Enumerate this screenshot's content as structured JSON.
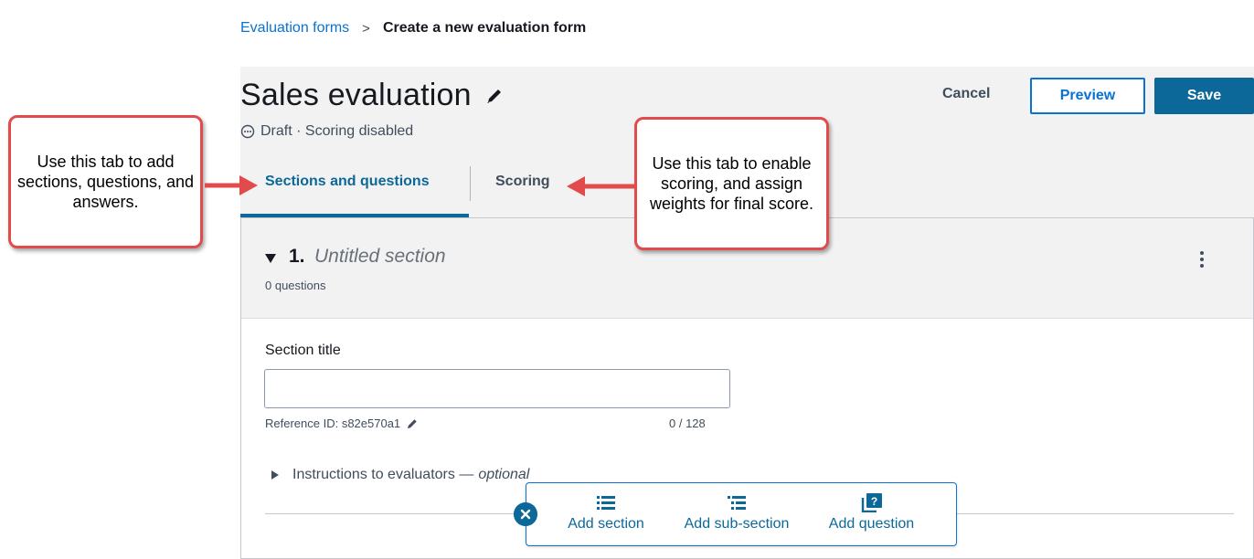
{
  "breadcrumb": {
    "parent": "Evaluation forms",
    "separator": ">",
    "current": "Create a new evaluation form"
  },
  "header": {
    "title": "Sales evaluation",
    "status": "Draft · Scoring disabled",
    "cancel_label": "Cancel",
    "preview_label": "Preview",
    "save_label": "Save"
  },
  "tabs": [
    {
      "label": "Sections and questions",
      "active": true
    },
    {
      "label": "Scoring",
      "active": false
    }
  ],
  "section": {
    "number": "1.",
    "name": "Untitled section",
    "question_count": "0 questions",
    "field_label": "Section title",
    "title_value": "",
    "reference_id": "Reference ID: s82e570a1",
    "char_count": "0 / 128",
    "instructions_label": "Instructions to evaluators —",
    "instructions_optional": "optional"
  },
  "toolbar": {
    "add_section": "Add section",
    "add_sub_section": "Add sub-section",
    "add_question": "Add question"
  },
  "callouts": {
    "left": "Use this tab to add sections, questions, and answers.",
    "right": "Use this tab to enable scoring, and assign weights for final score."
  },
  "colors": {
    "accent": "#0c6899",
    "link": "#0972d3",
    "callout_border": "#e14b4b",
    "header_bg": "#f2f2f2"
  },
  "icons": {
    "title_edit": "pencil-icon",
    "status": "draft-status-icon",
    "collapse": "caret-down-icon",
    "more": "kebab-menu-icon",
    "ref_edit": "pencil-icon",
    "instructions": "caret-right-icon",
    "add_section": "list-icon",
    "add_sub_section": "indented-list-icon",
    "add_question": "question-stack-icon",
    "close": "close-icon"
  }
}
